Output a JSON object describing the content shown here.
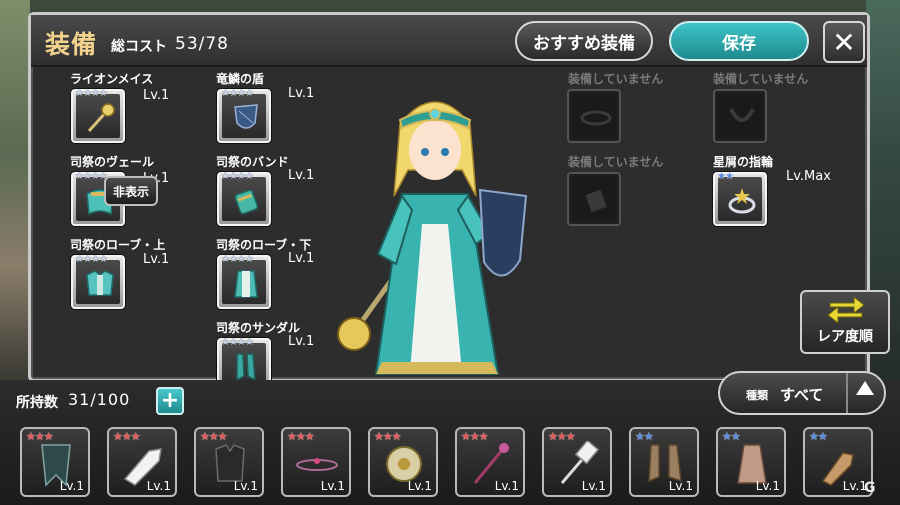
{
  "header": {
    "title": "装備",
    "cost_label": "総コスト",
    "cost_value": "53/78",
    "recommend_label": "おすすめ装備",
    "save_label": "保存",
    "close_icon": "close-icon"
  },
  "equipment_left": [
    {
      "name": "ライオンメイス",
      "level": "Lv.1",
      "stars": "★★★★",
      "icon": "mace-icon"
    },
    {
      "name": "司祭のヴェール",
      "level": "Lv.1",
      "stars": "★★★★",
      "icon": "veil-icon"
    },
    {
      "name": "司祭のローブ・上",
      "level": "Lv.1",
      "stars": "★★★★",
      "icon": "robe-top-icon"
    }
  ],
  "equipment_mid": [
    {
      "name": "竜鱗の盾",
      "level": "Lv.1",
      "stars": "★★★★",
      "icon": "shield-icon"
    },
    {
      "name": "司祭のバンド",
      "level": "Lv.1",
      "stars": "★★★★",
      "icon": "band-icon"
    },
    {
      "name": "司祭のローブ・下",
      "level": "Lv.1",
      "stars": "★★★★",
      "icon": "robe-bottom-icon"
    },
    {
      "name": "司祭のサンダル",
      "level": "Lv.1",
      "stars": "★★★★",
      "icon": "sandal-icon"
    }
  ],
  "hide_button": "非表示",
  "accessory_slots": {
    "empty_1": "装備していません",
    "empty_2": "装備していません",
    "empty_3": "装備していません",
    "ring_name": "星屑の指輪",
    "ring_level": "Lv.Max",
    "ring_stars": "★★"
  },
  "rare_sort_label": "レア度順",
  "inventory": {
    "count_label": "所持数",
    "count_value": "31/100",
    "add_icon": "+",
    "filter_label": "種類",
    "filter_value": "すべて",
    "items": [
      {
        "stars": "★★★",
        "star_color": "red",
        "level": "Lv.1",
        "icon": "cloak-icon"
      },
      {
        "stars": "★★★",
        "star_color": "red",
        "level": "Lv.1",
        "icon": "glove-icon"
      },
      {
        "stars": "★★★",
        "star_color": "red",
        "level": "Lv.1",
        "icon": "vest-icon"
      },
      {
        "stars": "★★★",
        "star_color": "red",
        "level": "Lv.1",
        "icon": "circlet-icon"
      },
      {
        "stars": "★★★",
        "star_color": "red",
        "level": "Lv.1",
        "icon": "round-shield-icon"
      },
      {
        "stars": "★★★",
        "star_color": "red",
        "level": "Lv.1",
        "icon": "staff-icon"
      },
      {
        "stars": "★★★",
        "star_color": "red",
        "level": "Lv.1",
        "icon": "hammer-icon"
      },
      {
        "stars": "★★",
        "star_color": "blue",
        "level": "Lv.1",
        "icon": "boots-icon"
      },
      {
        "stars": "★★",
        "star_color": "blue",
        "level": "Lv.1",
        "icon": "skirt-icon"
      },
      {
        "stars": "★★",
        "star_color": "blue",
        "level": "Lv.1",
        "icon": "gauntlet-icon"
      }
    ]
  },
  "colors": {
    "title_gold": "#f2d28c",
    "save_teal": "#2fa9ad",
    "star_red": "#e25a5a",
    "star_blue": "#5b8ee0"
  }
}
